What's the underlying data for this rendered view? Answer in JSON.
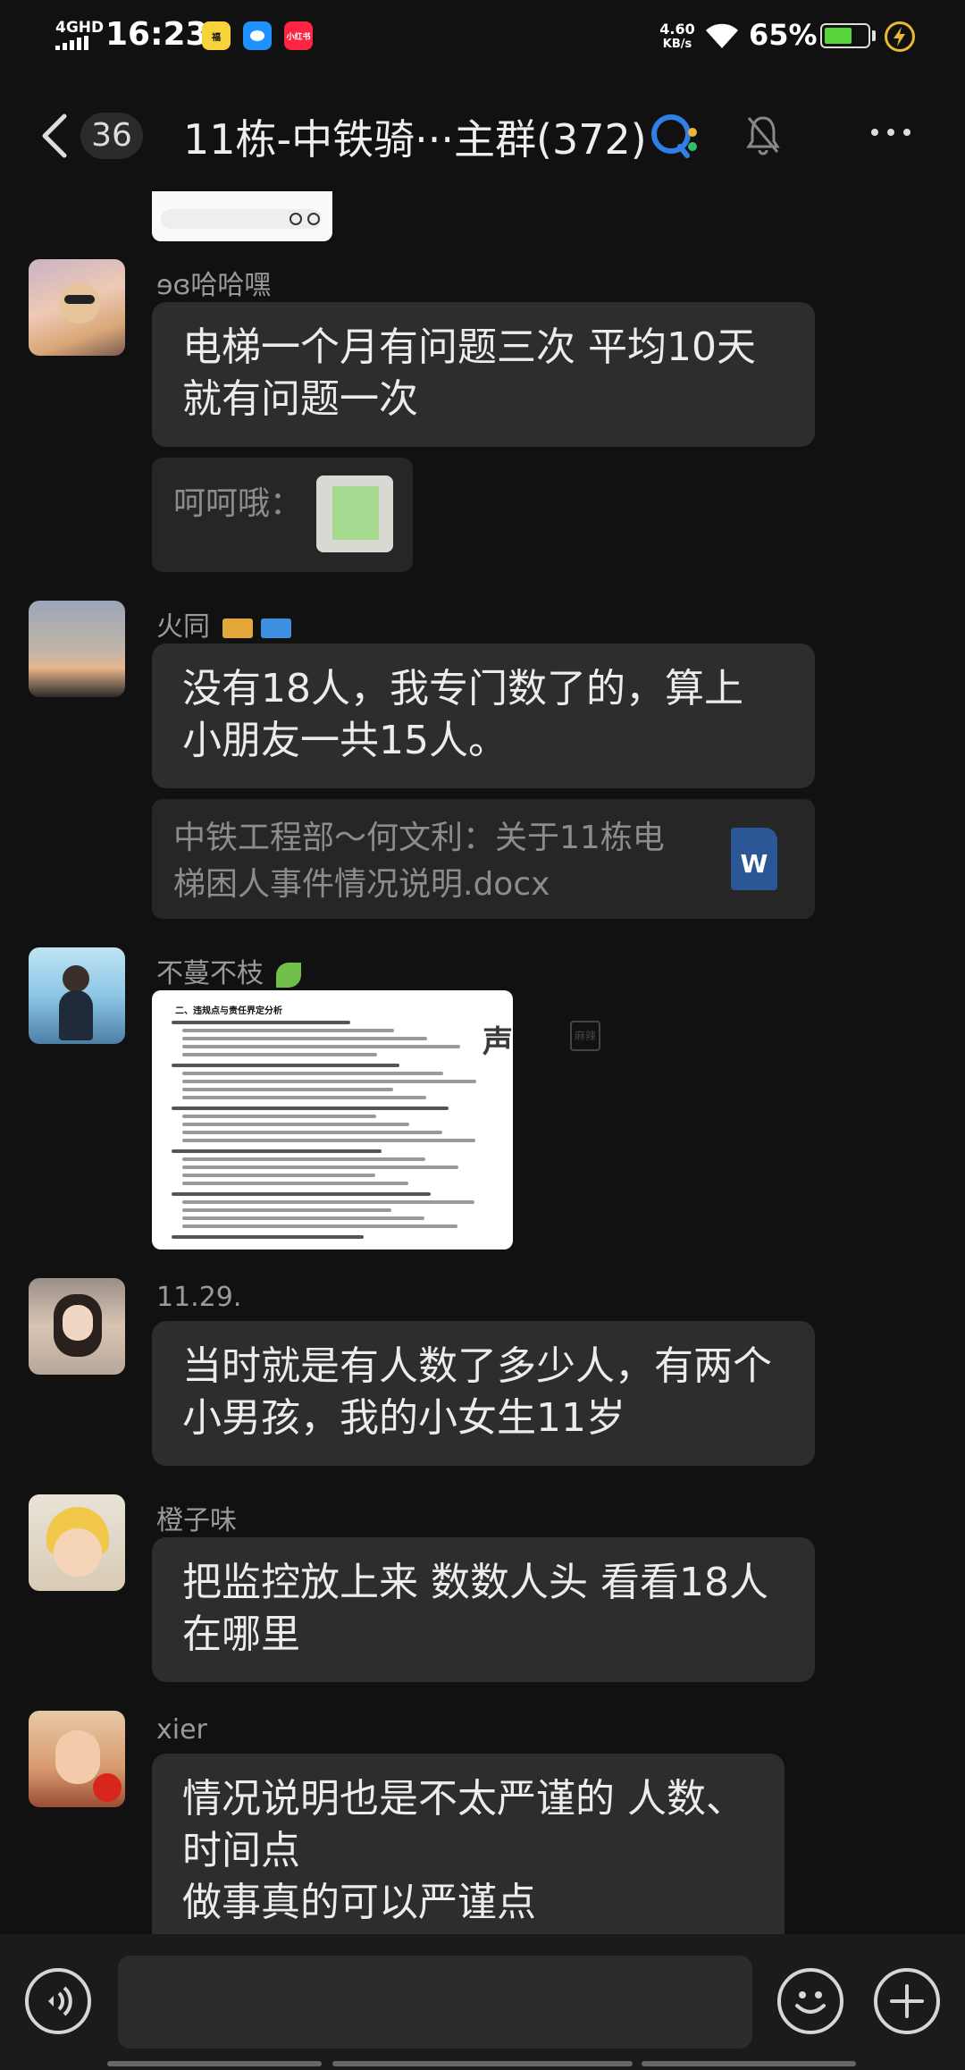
{
  "status_bar": {
    "network": "4GHD",
    "time": "16:23",
    "app_icons": [
      {
        "label": "福",
        "color": "#f7d23a"
      },
      {
        "label": "",
        "color": "#1e90ff"
      },
      {
        "label": "小红书",
        "color": "#ff2442"
      }
    ],
    "speed_value": "4.60",
    "speed_unit": "KB/s",
    "battery_percent": "65%",
    "battery_level": 0.65
  },
  "header": {
    "back_count": "36",
    "title": "11栋-中铁骑···主群(372)"
  },
  "messages": [
    {
      "sender": "ɘɞ哈哈嘿",
      "text_lines": [
        "电梯一个月有问题三次 平均10天",
        "就有问题一次"
      ],
      "quote_name": "呵呵哦："
    },
    {
      "sender": "火同",
      "text_lines": [
        "没有18人，我专门数了的，算上",
        "小朋友一共15人。"
      ],
      "quote_lines": [
        "中铁工程部～何文利：关于11栋电",
        "梯困人事件情况说明.docx"
      ],
      "doc_badge": "W"
    },
    {
      "sender": "不蔓不枝",
      "doc_heading": "二、违规点与责任界定分析",
      "watermark": "麻辣"
    },
    {
      "sender": "11.29.",
      "text_lines": [
        "当时就是有人数了多少人，有两个",
        "小男孩，我的小女生11岁"
      ]
    },
    {
      "sender": "橙子味",
      "text_lines": [
        "把监控放上来 数数人头 看看18人",
        "在哪里"
      ]
    },
    {
      "sender": "xier",
      "text_lines": [
        "情况说明也是不太严谨的  人数、",
        "时间点",
        "做事真的可以严谨点"
      ]
    }
  ],
  "colors": {
    "background": "#111111",
    "bubble": "#2d2d2d",
    "quote": "#262626",
    "word_doc": "#2b5797",
    "battery": "#57d53a"
  }
}
